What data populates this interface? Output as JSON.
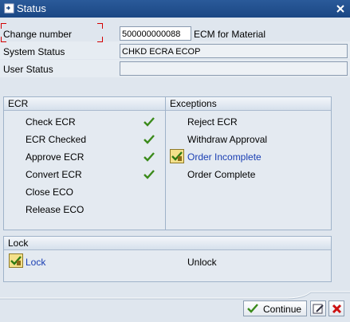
{
  "window": {
    "title": "Status"
  },
  "fields": {
    "change_number_label": "Change number",
    "change_number_value": "500000000088",
    "change_number_desc": "ECM for Material",
    "system_status_label": "System Status",
    "system_status_value": "CHKD ECRA ECOP",
    "user_status_label": "User Status",
    "user_status_value": ""
  },
  "ecr": {
    "title": "ECR",
    "items": [
      {
        "label": "Check ECR",
        "checked": true
      },
      {
        "label": "ECR Checked",
        "checked": true
      },
      {
        "label": "Approve ECR",
        "checked": true
      },
      {
        "label": "Convert ECR",
        "checked": true
      },
      {
        "label": "Close ECO",
        "checked": false
      },
      {
        "label": "Release ECO",
        "checked": false
      }
    ]
  },
  "exceptions": {
    "title": "Exceptions",
    "items": [
      {
        "label": "Reject ECR"
      },
      {
        "label": "Withdraw Approval"
      },
      {
        "label": "Order Incomplete",
        "active": true
      },
      {
        "label": "Order Complete"
      }
    ]
  },
  "lock": {
    "title": "Lock",
    "lock_label": "Lock",
    "unlock_label": "Unlock"
  },
  "buttons": {
    "continue_label": "Continue"
  },
  "colors": {
    "titlebar": "#1b4784",
    "link": "#1a3fb3",
    "check": "#3a8a1a",
    "cancel": "#cc1111"
  }
}
